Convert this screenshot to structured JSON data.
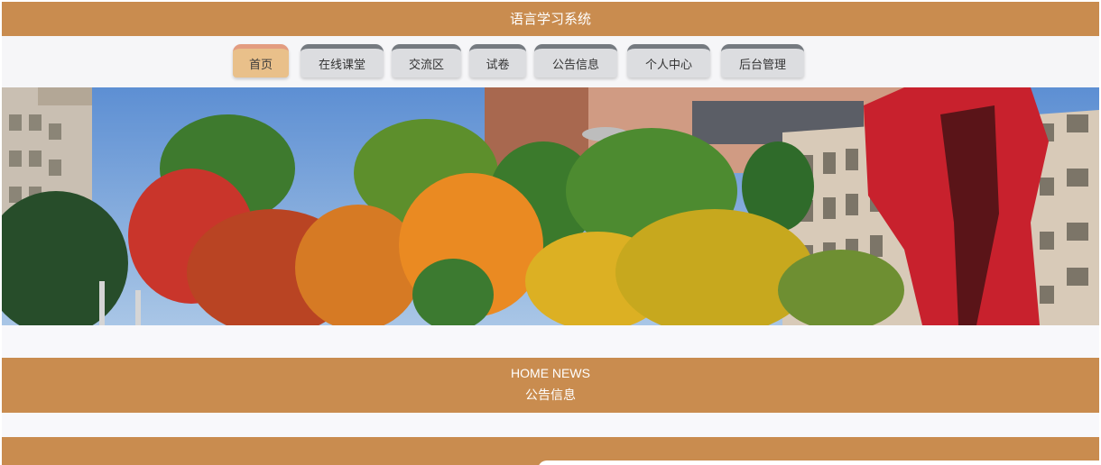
{
  "site": {
    "title": "语言学习系统"
  },
  "nav": {
    "items": [
      {
        "label": "首页",
        "active": true
      },
      {
        "label": "在线课堂",
        "active": false
      },
      {
        "label": "交流区",
        "active": false
      },
      {
        "label": "试卷",
        "active": false
      },
      {
        "label": "公告信息",
        "active": false
      },
      {
        "label": "个人中心",
        "active": false
      },
      {
        "label": "后台管理",
        "active": false
      }
    ]
  },
  "banner": {
    "alt": ""
  },
  "news": {
    "title_en": "HOME NEWS",
    "title_cn": "公告信息"
  },
  "colors": {
    "brand": "#c98c4f",
    "nav_active": "#e9c08a",
    "nav_inactive": "#dcdde0",
    "nav_tab": "#757a80"
  }
}
